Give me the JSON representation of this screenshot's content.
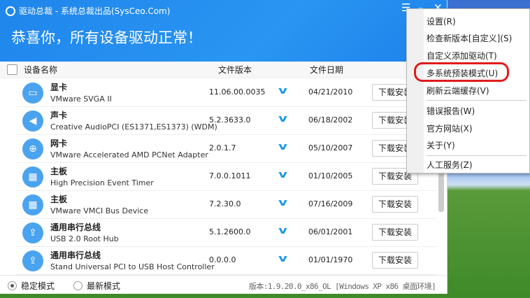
{
  "window": {
    "title": "驱动总裁 - 系统总裁出品(SysCeo.Com)",
    "headline": "恭喜你，所有设备驱动正常！"
  },
  "columns": {
    "name": "设备名称",
    "version": "文件版本",
    "date": "文件日期"
  },
  "rows": [
    {
      "category": "显卡",
      "device": "VMware SVGA II",
      "version": "11.06.00.0035",
      "date": "04/21/2010",
      "action": "下载安装",
      "icon": "monitor-icon",
      "glyph": "▭"
    },
    {
      "category": "声卡",
      "device": "Creative AudioPCI (ES1371,ES1373) (WDM)",
      "version": "5.2.3633.0",
      "date": "06/18/2002",
      "action": "下载安装",
      "icon": "speaker-icon",
      "glyph": "◀"
    },
    {
      "category": "网卡",
      "device": "VMware Accelerated AMD PCNet Adapter",
      "version": "2.0.1.7",
      "date": "05/10/2007",
      "action": "下载安装",
      "icon": "globe-icon",
      "glyph": "⊕"
    },
    {
      "category": "主板",
      "device": "High Precision Event Timer",
      "version": "7.0.0.1011",
      "date": "01/10/2005",
      "action": "下载安装",
      "icon": "motherboard-icon",
      "glyph": "▦"
    },
    {
      "category": "主板",
      "device": "VMware VMCI Bus Device",
      "version": "7.2.30.0",
      "date": "07/16/2009",
      "action": "下载安装",
      "icon": "motherboard-icon",
      "glyph": "▦"
    },
    {
      "category": "通用串行总线",
      "device": "USB 2.0 Root Hub",
      "version": "5.1.2600.0",
      "date": "06/01/2001",
      "action": "下载安装",
      "icon": "usb-icon",
      "glyph": "⇪"
    },
    {
      "category": "通用串行总线",
      "device": "Stand Universal PCI to USB Host Controller",
      "version": "0.0.0.0",
      "date": "01/01/1970",
      "action": "下载安装",
      "icon": "usb-icon",
      "glyph": "⇪"
    }
  ],
  "footer": {
    "stable": "稳定模式",
    "latest": "最新模式",
    "version_info": "版本:1.9.20.0_x86_OL [Windows XP x86 桌面环境]"
  },
  "menu": [
    "设置(R)",
    "检查新版本[自定义](S)",
    "自定义添加驱动(T)",
    "多系统预装模式(U)",
    "刷新云端缓存(V)",
    "错误报告(W)",
    "官方网站(X)",
    "关于(Y)",
    "人工服务(Z)"
  ]
}
